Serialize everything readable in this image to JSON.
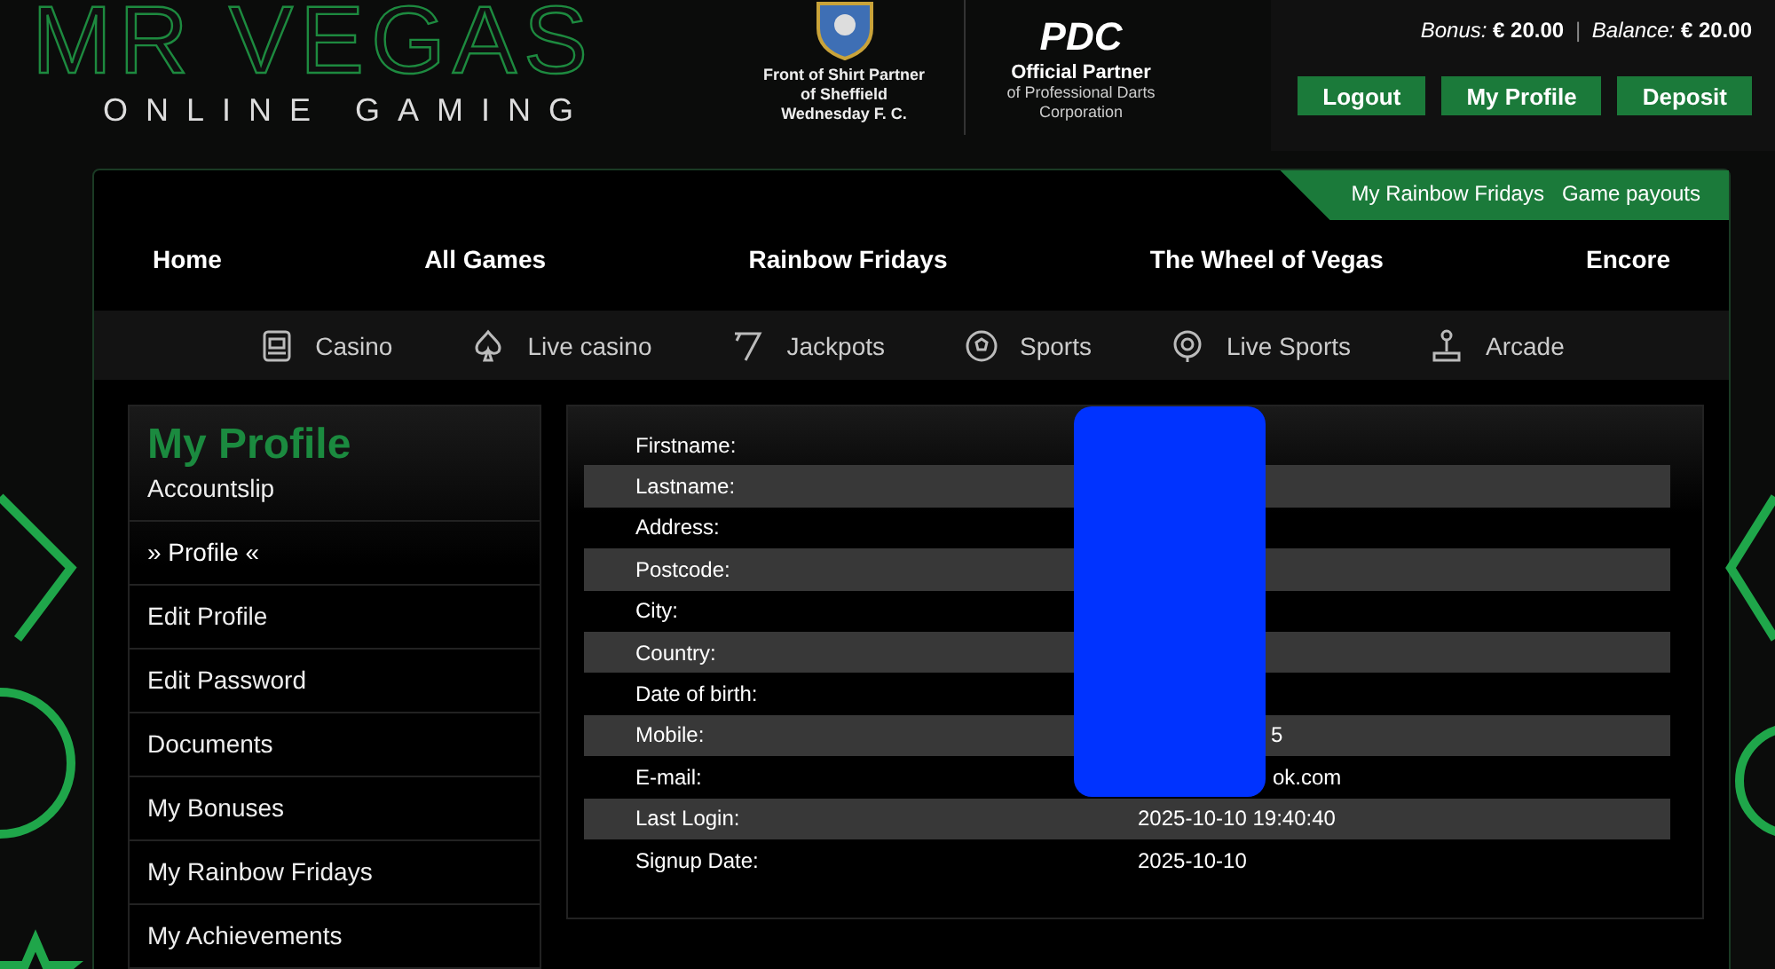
{
  "logo": {
    "title": "MR VEGAS",
    "tagline": "ONLINE GAMING"
  },
  "partners": [
    {
      "kind": "crest",
      "lines": [
        "Front of Shirt Partner",
        "of Sheffield",
        "Wednesday F. C."
      ]
    },
    {
      "kind": "pdc",
      "mark": "PDC",
      "heading": "Official Partner",
      "lines": [
        "of Professional Darts",
        "Corporation"
      ]
    }
  ],
  "account": {
    "bonus": "*Bonus:* **€ 20.00**",
    "separator": "|",
    "balance": "*Balance:* **€ 20.00**",
    "buttons": [
      "Logout",
      "My Profile",
      "Deposit"
    ]
  },
  "top_links": [
    "My Rainbow Fridays",
    "Game payouts"
  ],
  "main_nav": [
    "Home",
    "All Games",
    "Rainbow Fridays",
    "The Wheel of Vegas",
    "Encore"
  ],
  "sub_nav": [
    {
      "kind": "slot",
      "label": "Casino"
    },
    {
      "kind": "spade",
      "label": "Live casino"
    },
    {
      "kind": "seven",
      "label": "Jackpots"
    },
    {
      "kind": "ball",
      "label": "Sports"
    },
    {
      "kind": "pin",
      "label": "Live Sports"
    },
    {
      "kind": "joystick",
      "label": "Arcade"
    }
  ],
  "sidebar": {
    "title": "My Profile",
    "items": [
      {
        "label": "Accountslip",
        "selected": false
      },
      {
        "label": "» Profile «",
        "selected": true
      },
      {
        "label": "Edit Profile",
        "selected": false
      },
      {
        "label": "Edit Password",
        "selected": false
      },
      {
        "label": "Documents",
        "selected": false
      },
      {
        "label": "My Bonuses",
        "selected": false
      },
      {
        "label": "My Rainbow Fridays",
        "selected": false
      },
      {
        "label": "My Achievements",
        "selected": false
      }
    ]
  },
  "profile": [
    {
      "label": "Firstname:"
    },
    {
      "label": "Lastname:"
    },
    {
      "label": "Address:"
    },
    {
      "label": "Postcode:"
    },
    {
      "label": "City:"
    },
    {
      "label": "Country:"
    },
    {
      "label": "Date of birth:"
    },
    {
      "label": "Mobile:",
      "value": "5",
      "partly_hidden": true
    },
    {
      "label": "E-mail:",
      "value": "ok.com",
      "partly_hidden": true
    },
    {
      "label": "Last Login:",
      "value": "2025-10-10 19:40:40",
      "partly_hidden": false
    },
    {
      "label": "Signup Date:",
      "value": "2025-10-10",
      "partly_hidden": false
    }
  ]
}
